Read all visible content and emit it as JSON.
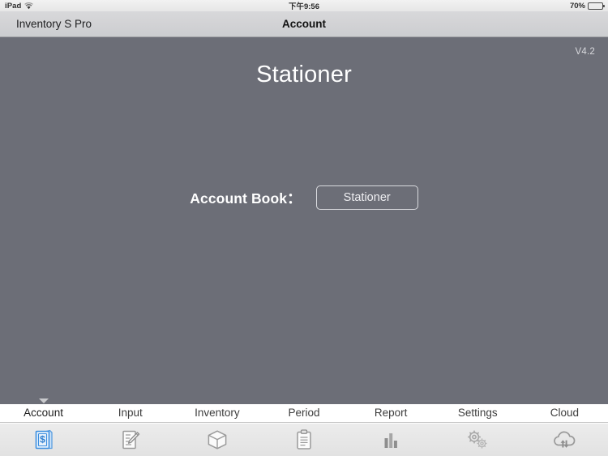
{
  "status_bar": {
    "device": "iPad",
    "wifi_icon": "wifi-icon",
    "time": "下午9:56",
    "battery_percent": "70%",
    "battery_level": 70
  },
  "nav_bar": {
    "left_title": "Inventory S Pro",
    "center_title": "Account"
  },
  "content": {
    "version": "V4.2",
    "app_title": "Stationer",
    "account_book_label": "Account Book：",
    "account_book_value": "Stationer"
  },
  "tab_bar": {
    "active_index": 0,
    "tabs": [
      {
        "label": "Account",
        "icon": "account-book-dollar-icon"
      },
      {
        "label": "Input",
        "icon": "pencil-note-icon"
      },
      {
        "label": "Inventory",
        "icon": "box-cube-icon"
      },
      {
        "label": "Period",
        "icon": "clipboard-icon"
      },
      {
        "label": "Report",
        "icon": "bar-chart-icon"
      },
      {
        "label": "Settings",
        "icon": "gears-icon"
      },
      {
        "label": "Cloud",
        "icon": "cloud-sync-icon"
      }
    ]
  },
  "colors": {
    "content_background": "#6c6e77",
    "nav_background": "#d2d3d6",
    "accent_active": "#3d8fe0",
    "tab_icon_inactive": "#9a9a9a",
    "title_text": "#ffffff"
  }
}
